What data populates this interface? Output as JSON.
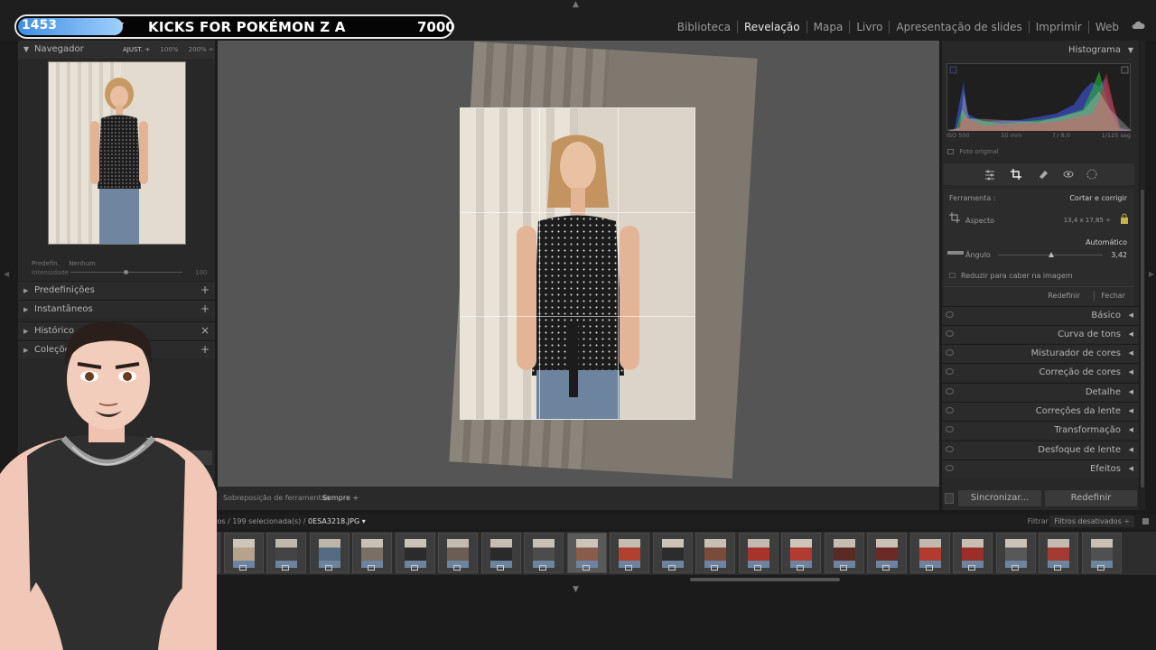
{
  "stream_counter": {
    "current": "1453",
    "title": "KICKS FOR POKÉMON Z A",
    "goal": "7000"
  },
  "modules": [
    "Biblioteca",
    "Revelação",
    "Mapa",
    "Livro",
    "Apresentação de slides",
    "Imprimir",
    "Web"
  ],
  "active_module": "Revelação",
  "left_panel": {
    "navigator": {
      "title": "Navegador",
      "zoom_options": [
        "AJUST. ÷",
        "100%",
        "200% ÷"
      ]
    },
    "preset": {
      "label": "Predefin.",
      "value": "Nenhum",
      "intensity_label": "Intensidade",
      "intensity_value": "100"
    },
    "sections": [
      {
        "label": "Predefinições",
        "action": "+"
      },
      {
        "label": "Instantâneos",
        "action": "+"
      },
      {
        "label": "Histórico",
        "action": "×"
      },
      {
        "label": "Coleções",
        "action": "+"
      }
    ]
  },
  "toolbar": {
    "overlay_label": "Sobreposição de ferramentas",
    "overlay_value": "Sempre ÷"
  },
  "right_panel": {
    "histogram": {
      "title": "Histograma",
      "iso": "ISO 500",
      "focal": "50 mm",
      "aperture": "f / 8,0",
      "shutter": "1/125 seg",
      "original_photo_label": "Foto original"
    },
    "crop": {
      "tool_label": "Ferramenta :",
      "tool_value": "Cortar e corrigir",
      "aspect_label": "Aspecto",
      "aspect_value": "13,4 x 17,85 ÷",
      "auto_label": "Automático",
      "angle_label": "Ângulo",
      "angle_value": "3,42",
      "constrain_label": "Reduzir para caber na imagem",
      "reset_label": "Redefinir",
      "close_label": "Fechar"
    },
    "sections": [
      "Básico",
      "Curva de tons",
      "Misturador de cores",
      "Correção de cores",
      "Detalhe",
      "Correções da lente",
      "Transformação",
      "Desfoque de lente",
      "Efeitos"
    ],
    "sync_label": "Sincronizar...",
    "reset_label": "Redefinir"
  },
  "filmstrip": {
    "info_prefix": "9 fotos / 199 selecionada(s) /",
    "current_file": "0ESA3218.JPG ▾",
    "filter_label": "Filtrar :",
    "filter_value": "Filtros desativados ÷",
    "thumb_colors": [
      "#c8c0b5",
      "#d0c8bd",
      "#cfc7bc",
      "#c5bdb2",
      "#d2cabf",
      "#cdc5ba",
      "#c0b8ad",
      "#bdb5aa",
      "#c9c1b6",
      "#cac2b7",
      "#c3bbb0",
      "#c6beb3",
      "#c8c0b5",
      "#ccc4b9",
      "#c4bcb1",
      "#cbc3b8",
      "#c7bfb4",
      "#c2bab0",
      "#cdc5ba",
      "#c5bdb2",
      "#c9c1b6",
      "#c1b9ae",
      "#c6beb3",
      "#cac2b7",
      "#c3bbb0",
      "#c8c0b5"
    ],
    "outfit_colors": [
      "#8a6f5a",
      "#5b6f86",
      "#c9b9a3",
      "#3c3c3c",
      "#9a7f69",
      "#b7a38c",
      "#444",
      "#556b83",
      "#7b6e64",
      "#2b2b2b",
      "#6b5d54",
      "#2a2a2a",
      "#4c4c4c",
      "#8a5a4a",
      "#b1402e",
      "#2c2c2c",
      "#7a4b3a",
      "#a8332a",
      "#b33a2f",
      "#5a2b24",
      "#6c2a24",
      "#b33a2f",
      "#9b2f27",
      "#585858",
      "#a33b30",
      "#505050"
    ]
  }
}
